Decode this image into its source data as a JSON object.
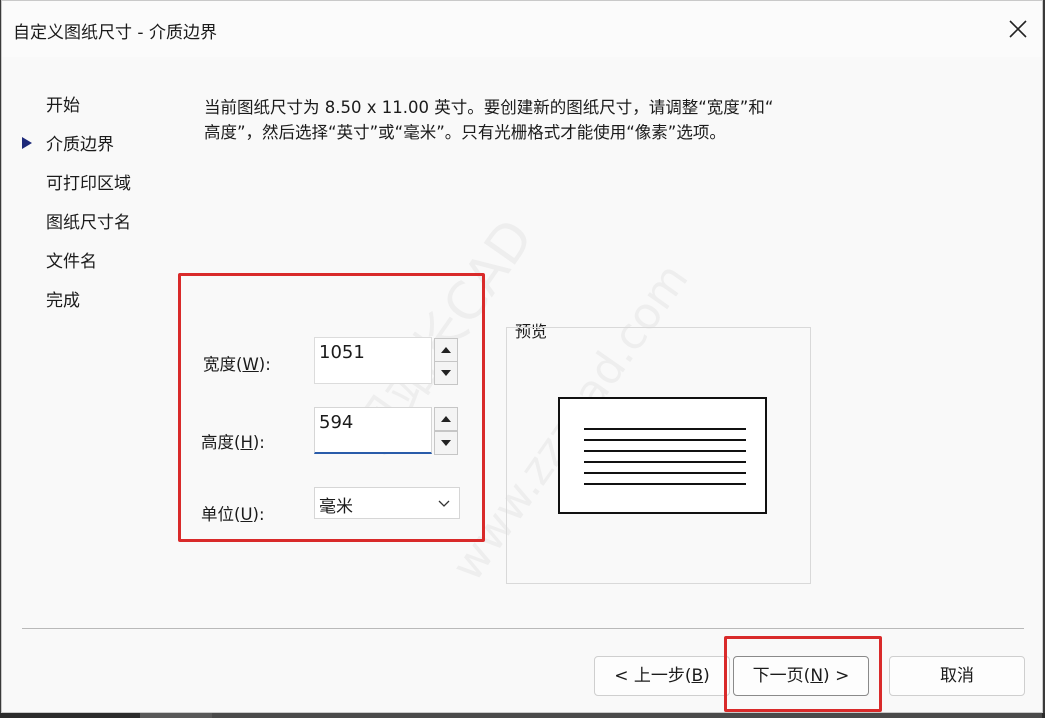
{
  "dialog": {
    "title": "自定义图纸尺寸 - 介质边界"
  },
  "nav": {
    "items": [
      {
        "label": "开始",
        "current": false
      },
      {
        "label": "介质边界",
        "current": true
      },
      {
        "label": "可打印区域",
        "current": false
      },
      {
        "label": "图纸尺寸名",
        "current": false
      },
      {
        "label": "文件名",
        "current": false
      },
      {
        "label": "完成",
        "current": false
      }
    ]
  },
  "description": {
    "line1": "当前图纸尺寸为 8.50 x 11.00 英寸。要创建新的图纸尺寸，请调整“宽度”和“",
    "line2": "高度”，然后选择“英寸”或“毫米”。只有光栅格式才能使用“像素”选项。"
  },
  "form": {
    "width": {
      "label_pre": "宽度(",
      "label_key": "W",
      "label_post": "):",
      "value": "1051"
    },
    "height": {
      "label_pre": "高度(",
      "label_key": "H",
      "label_post": "):",
      "value": "594"
    },
    "unit": {
      "label_pre": "单位(",
      "label_key": "U",
      "label_post": "):",
      "value": "毫米"
    }
  },
  "preview": {
    "label": "预览"
  },
  "buttons": {
    "back_pre": "< 上一步(",
    "back_key": "B",
    "back_post": ")",
    "next_pre": "下一页(",
    "next_key": "N",
    "next_post": ") >",
    "cancel": "取消"
  },
  "watermark": {
    "line1": "周站长CAD",
    "line2": "www.zzzcad.com"
  },
  "colors": {
    "highlight_red": "#d92a2a",
    "nav_arrow": "#1e2a7a",
    "focus_underline": "#2a5caa"
  }
}
